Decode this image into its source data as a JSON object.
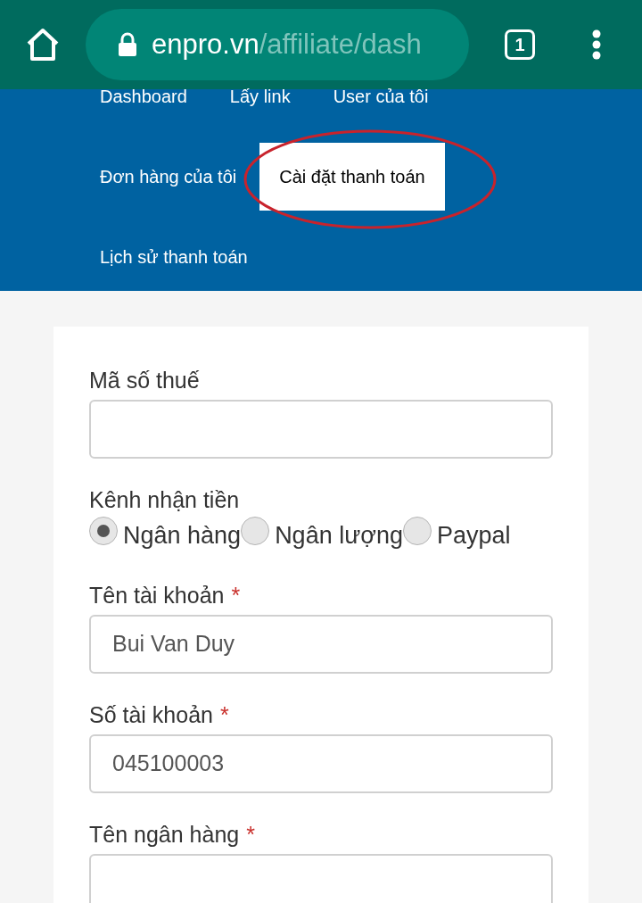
{
  "browser": {
    "url_domain": "enpro.vn",
    "url_path": "/affiliate/dash",
    "tab_count": "1"
  },
  "nav": [
    {
      "label": "Dashboard",
      "selected": false
    },
    {
      "label": "Lấy link",
      "selected": false
    },
    {
      "label": "User của tôi",
      "selected": false
    },
    {
      "label": "Đơn hàng của tôi",
      "selected": false
    },
    {
      "label": "Cài đặt thanh toán",
      "selected": true
    },
    {
      "label": "Lịch sử thanh toán",
      "selected": false
    }
  ],
  "form": [
    {
      "kind": "text",
      "label": "Mã số thuế"
    },
    {
      "kind": "radio",
      "label": "Kênh nhận tiền",
      "options": [
        {
          "label": "Ngân hàng",
          "selected": true
        },
        {
          "label": "Ngân lượng",
          "selected": false
        },
        {
          "label": "Paypal",
          "selected": false
        }
      ]
    },
    {
      "kind": "text",
      "label": "Tên tài khoản",
      "required_mark": "*",
      "value": "Bui Van Duy"
    },
    {
      "kind": "text",
      "label": "Số tài khoản",
      "required_mark": "*",
      "value": "045100003"
    },
    {
      "kind": "text",
      "label": "Tên ngân hàng",
      "required_mark": "*"
    }
  ]
}
